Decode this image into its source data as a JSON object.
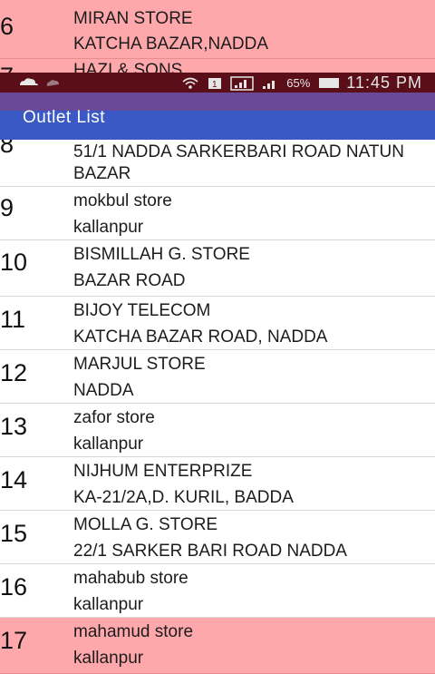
{
  "status_bar": {
    "battery_percent": "65%",
    "time": "11:45 PM"
  },
  "app_bar": {
    "title": "Outlet List"
  },
  "outlets": [
    {
      "num": "6",
      "name": "MIRAN STORE",
      "address": "KATCHA BAZAR,NADDA",
      "highlighted": true
    },
    {
      "num": "7",
      "name": "HAZI & SONS",
      "address": "",
      "highlighted": true
    },
    {
      "num": "8",
      "name": "",
      "address_line1": "51/1 NADDA SARKERBARI ROAD NATUN",
      "address_line2": "BAZAR",
      "highlighted": false
    },
    {
      "num": "9",
      "name": "mokbul store",
      "address": "kallanpur",
      "highlighted": false
    },
    {
      "num": "10",
      "name": "BISMILLAH G. STORE",
      "address": "BAZAR ROAD",
      "highlighted": false
    },
    {
      "num": "11",
      "name": "BIJOY TELECOM",
      "address": "KATCHA BAZAR ROAD, NADDA",
      "highlighted": false
    },
    {
      "num": "12",
      "name": "MARJUL STORE",
      "address": "NADDA",
      "highlighted": false
    },
    {
      "num": "13",
      "name": "zafor store",
      "address": "kallanpur",
      "highlighted": false
    },
    {
      "num": "14",
      "name": "NIJHUM ENTERPRIZE",
      "address": "KA-21/2A,D. KURIL, BADDA",
      "highlighted": false
    },
    {
      "num": "15",
      "name": "MOLLA G. STORE",
      "address": "22/1 SARKER BARI ROAD NADDA",
      "highlighted": false
    },
    {
      "num": "16",
      "name": "mahabub store",
      "address": "kallanpur",
      "highlighted": false
    },
    {
      "num": "17",
      "name": "mahamud store",
      "address": "kallanpur",
      "highlighted": true
    }
  ],
  "colors": {
    "highlight": "#ffa8ac",
    "status_bar": "#5a0f18",
    "app_bar": "#3b59c4"
  }
}
